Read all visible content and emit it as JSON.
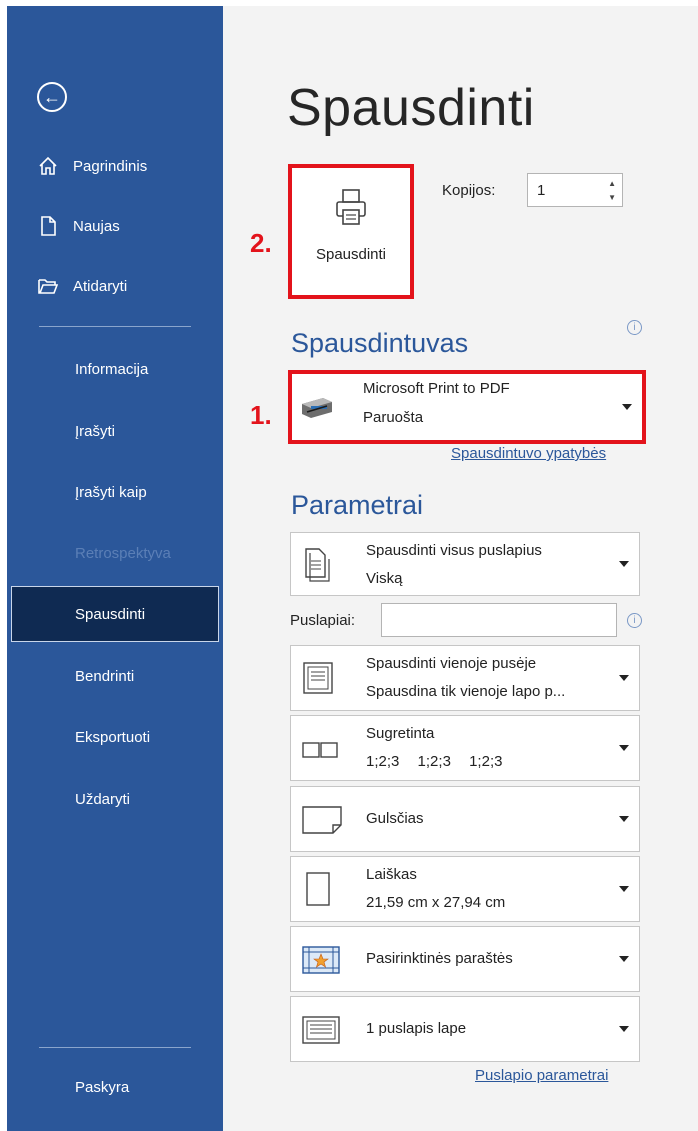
{
  "sidebar": {
    "back_icon": "back-arrow-icon",
    "top_items": [
      {
        "label": "Pagrindinis",
        "icon": "home-icon"
      },
      {
        "label": "Naujas",
        "icon": "new-document-icon"
      },
      {
        "label": "Atidaryti",
        "icon": "open-folder-icon"
      }
    ],
    "items": [
      {
        "label": "Informacija"
      },
      {
        "label": "Įrašyti"
      },
      {
        "label": "Įrašyti kaip"
      },
      {
        "label": "Retrospektyva"
      },
      {
        "label": "Spausdinti"
      },
      {
        "label": "Bendrinti"
      },
      {
        "label": "Eksportuoti"
      },
      {
        "label": "Uždaryti"
      }
    ],
    "account_label": "Paskyra"
  },
  "main": {
    "title": "Spausdinti",
    "print_button_label": "Spausdinti",
    "step_2": "2.",
    "step_1": "1.",
    "copies_label": "Kopijos:",
    "copies_value": "1",
    "printer_section": "Spausdintuvas",
    "printer_name": "Microsoft Print to PDF",
    "printer_status": "Paruošta",
    "printer_properties_link": "Spausdintuvo ypatybės",
    "settings_section": "Parametrai",
    "settings": [
      {
        "line1": "Spausdinti visus puslapius",
        "line2": "Viską"
      },
      {
        "line1": "Spausdinti vienoje pusėje",
        "line2": "Spausdina tik vienoje lapo p..."
      },
      {
        "line1": "Sugretinta",
        "collate": [
          "1;2;3",
          "1;2;3",
          "1;2;3"
        ]
      },
      {
        "line1": "Gulsčias"
      },
      {
        "line1": "Laiškas",
        "line2": "21,59 cm x 27,94 cm"
      },
      {
        "line1": "Pasirinktinės paraštės"
      },
      {
        "line1": "1 puslapis lape"
      }
    ],
    "pages_label": "Puslapiai:",
    "pages_value": "",
    "page_setup_link": "Puslapio parametrai"
  },
  "colors": {
    "sidebar_bg": "#2b579a",
    "sidebar_selected": "#0f2a52",
    "accent": "#2b579a",
    "highlight": "#e3131b"
  }
}
